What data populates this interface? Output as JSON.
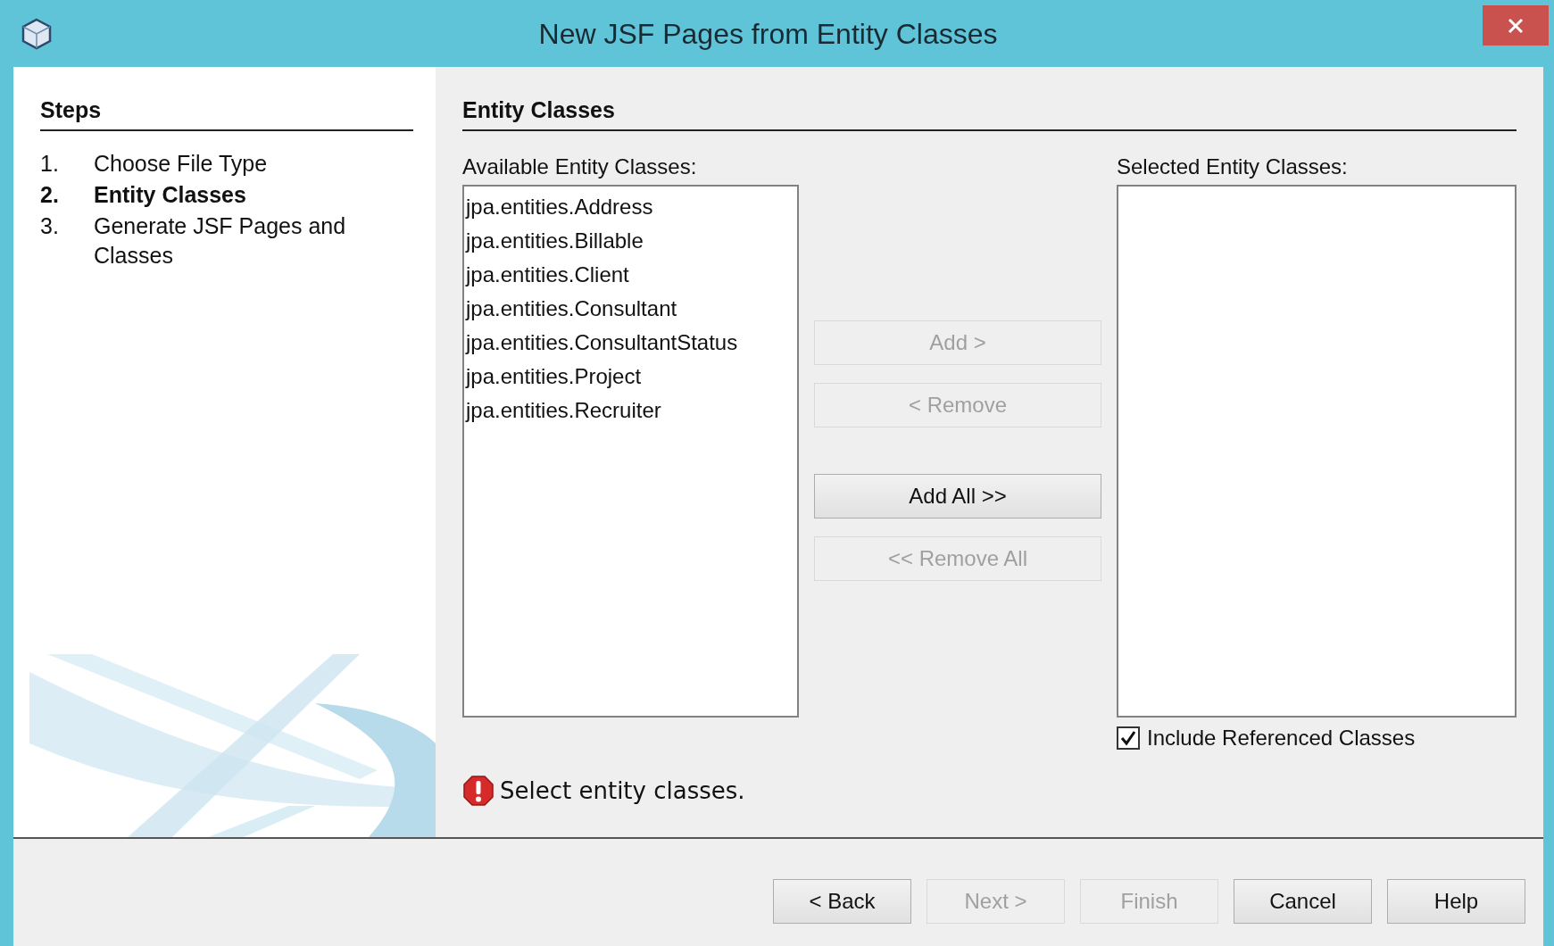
{
  "window": {
    "title": "New JSF Pages from Entity Classes"
  },
  "steps": {
    "heading": "Steps",
    "items": [
      {
        "number": "1.",
        "label": "Choose File Type",
        "selected": false
      },
      {
        "number": "2.",
        "label": "Entity Classes",
        "selected": true
      },
      {
        "number": "3.",
        "label": "Generate JSF Pages and Classes",
        "selected": false
      }
    ]
  },
  "panel": {
    "heading": "Entity Classes",
    "available": {
      "label": "Available Entity Classes:",
      "items": [
        "jpa.entities.Address",
        "jpa.entities.Billable",
        "jpa.entities.Client",
        "jpa.entities.Consultant",
        "jpa.entities.ConsultantStatus",
        "jpa.entities.Project",
        "jpa.entities.Recruiter"
      ]
    },
    "transfer_buttons": [
      {
        "label": "Add >",
        "disabled": true
      },
      {
        "label": "< Remove",
        "disabled": true
      },
      {
        "label": "Add All >>",
        "disabled": false
      },
      {
        "label": "<< Remove All",
        "disabled": true
      }
    ],
    "selected": {
      "label": "Selected Entity Classes:"
    },
    "include_referenced": {
      "label": "Include Referenced Classes",
      "checked": true
    },
    "error": "Select entity classes."
  },
  "footer_buttons": [
    {
      "label": "< Back",
      "disabled": false
    },
    {
      "label": "Next >",
      "disabled": true
    },
    {
      "label": "Finish",
      "disabled": true
    },
    {
      "label": "Cancel",
      "disabled": false
    },
    {
      "label": "Help",
      "disabled": false
    }
  ]
}
